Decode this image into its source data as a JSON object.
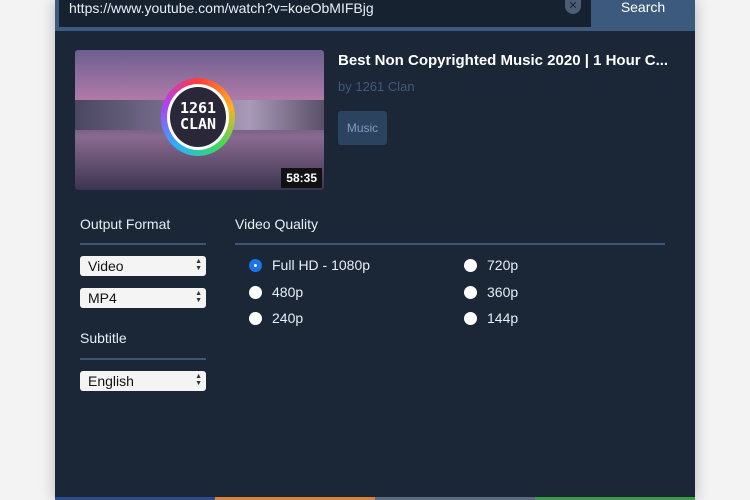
{
  "search": {
    "url": "https://www.youtube.com/watch?v=koeObMIFBjg",
    "button": "Search",
    "clear_icon": "close-circle-icon"
  },
  "video": {
    "title": "Best Non Copyrighted Music 2020 | 1 Hour C...",
    "channel": "by 1261 Clan",
    "tag": "Music",
    "duration": "58:35",
    "logo_text": "1261 CLAN"
  },
  "output_format": {
    "label": "Output Format",
    "type": "Video",
    "container": "MP4"
  },
  "subtitle": {
    "label": "Subtitle",
    "value": "English"
  },
  "quality": {
    "label": "Video Quality",
    "selected": "Full HD - 1080p",
    "options": [
      "Full HD - 1080p",
      "720p",
      "480p",
      "360p",
      "240p",
      "144p"
    ]
  },
  "colors": {
    "background": "#1b2636",
    "accent": "#3c5a7e",
    "radio_selected": "#1a73e8",
    "strip": [
      "#2f4a8a",
      "#d9843c",
      "#5a6b80",
      "#3c9a4a"
    ]
  }
}
